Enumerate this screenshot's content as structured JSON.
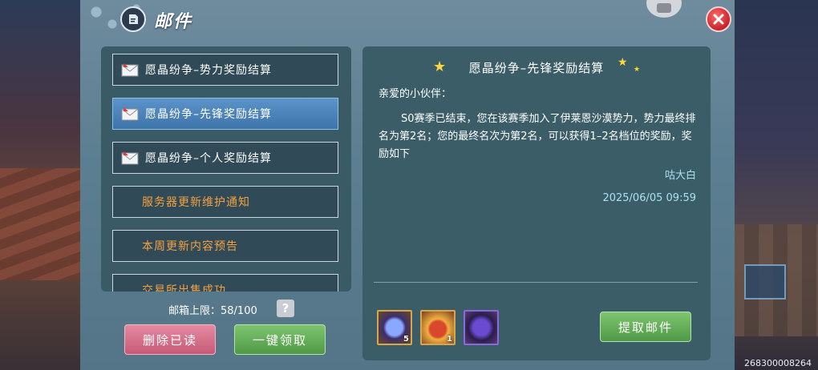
{
  "header": {
    "title": "邮件"
  },
  "mail_list": [
    {
      "label": "愿晶纷争–势力奖励结算",
      "type": "envelope",
      "selected": false
    },
    {
      "label": "愿晶纷争–先锋奖励结算",
      "type": "envelope",
      "selected": true
    },
    {
      "label": "愿晶纷争–个人奖励结算",
      "type": "envelope",
      "selected": false
    },
    {
      "label": "服务器更新维护通知",
      "type": "notice",
      "selected": false
    },
    {
      "label": "本周更新内容预告",
      "type": "notice",
      "selected": false
    },
    {
      "label": "交易所出售成功",
      "type": "notice",
      "selected": false
    }
  ],
  "mailbox": {
    "capacity_text": "邮箱上限：58/100",
    "help": "?"
  },
  "buttons": {
    "delete_read": "删除已读",
    "claim_all": "一键领取",
    "collect_mail": "提取邮件"
  },
  "detail": {
    "title": "愿晶纷争–先锋奖励结算",
    "greeting": "亲爱的小伙伴：",
    "body": "S0赛季已结束，您在该赛季加入了伊莱恩沙漠势力，势力最终排名为第2名；您的最终名次为第2名，可以获得1–2名档位的奖励，奖励如下",
    "sender": "咕大白",
    "date": "2025/06/05 09:59",
    "rewards": [
      {
        "icon": "blue-crystal-item-icon",
        "count": "5"
      },
      {
        "icon": "red-bell-item-icon",
        "count": "1"
      },
      {
        "icon": "purple-emblem-item-icon",
        "count": ""
      }
    ]
  },
  "footer": {
    "uid": "268300008264"
  },
  "colors": {
    "accent_green": "#4f9a46",
    "accent_pink": "#c65a78",
    "notice_orange": "#f4a040",
    "selected_blue": "#3d74aa"
  }
}
